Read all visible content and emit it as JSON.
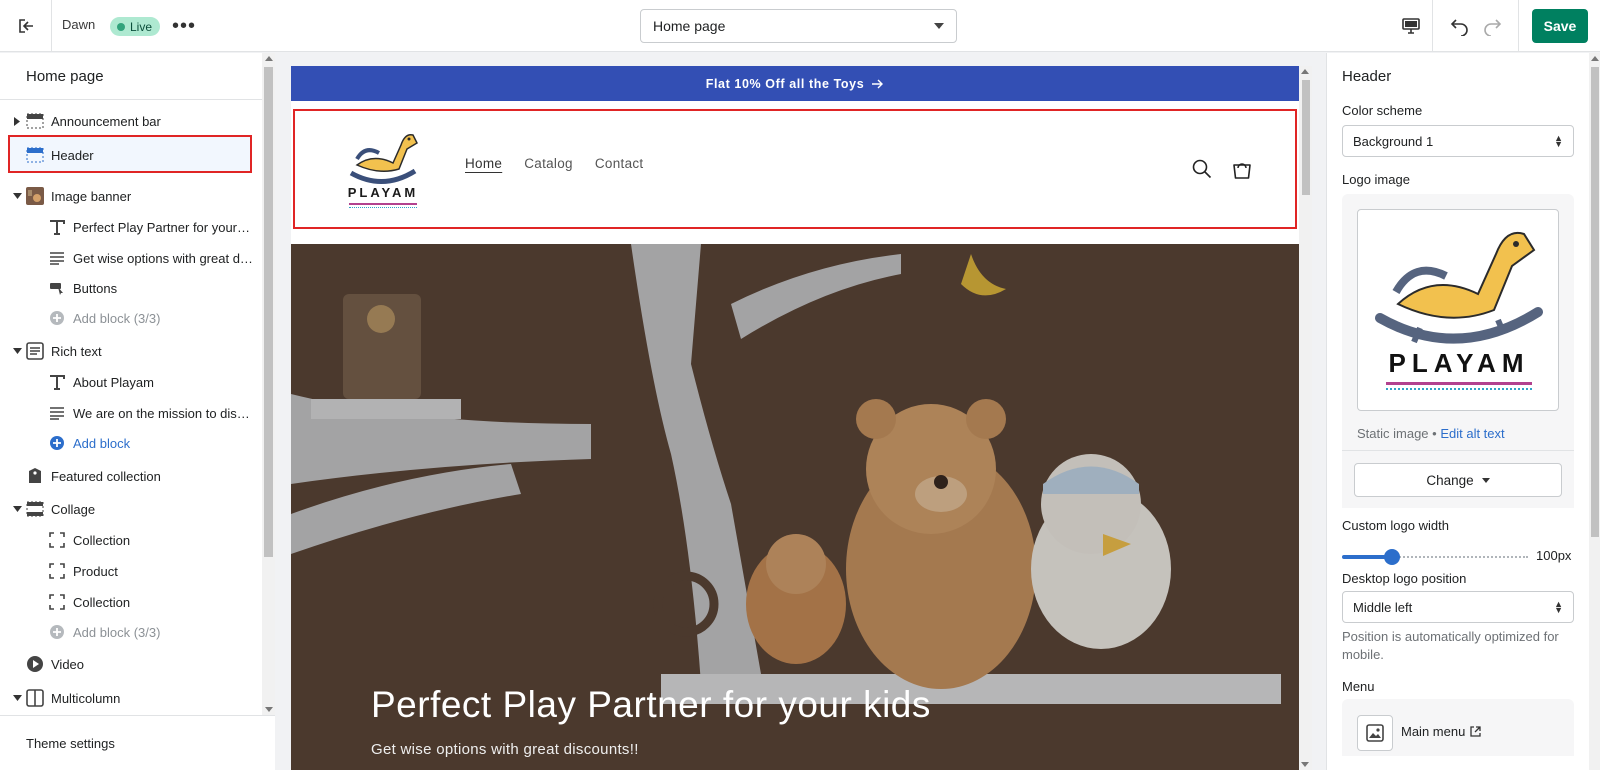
{
  "topbar": {
    "theme_name": "Dawn",
    "status_badge": "Live",
    "more_label": "•••",
    "page_selector": "Home page",
    "save_label": "Save"
  },
  "left_panel": {
    "title": "Home page",
    "items": [
      {
        "label": "Announcement bar",
        "icon": "announcement-bar-icon"
      },
      {
        "label": "Header",
        "icon": "header-section-icon"
      },
      {
        "label": "Image banner",
        "icon": "image-banner-thumbnail"
      },
      {
        "label": "Perfect Play Partner for your k...",
        "icon": "text-heading-icon"
      },
      {
        "label": "Get wise options with great di...",
        "icon": "paragraph-icon"
      },
      {
        "label": "Buttons",
        "icon": "buttons-icon"
      },
      {
        "label": "Add block (3/3)",
        "icon": "add-circle-icon"
      },
      {
        "label": "Rich text",
        "icon": "rich-text-icon"
      },
      {
        "label": "About Playam",
        "icon": "text-heading-icon"
      },
      {
        "label": "We are on the mission to disc...",
        "icon": "paragraph-icon"
      },
      {
        "label": "Add block",
        "icon": "add-circle-icon"
      },
      {
        "label": "Featured collection",
        "icon": "collection-tag-icon"
      },
      {
        "label": "Collage",
        "icon": "collage-icon"
      },
      {
        "label": "Collection",
        "icon": "dashed-box-icon"
      },
      {
        "label": "Product",
        "icon": "dashed-box-icon"
      },
      {
        "label": "Collection",
        "icon": "dashed-box-icon"
      },
      {
        "label": "Add block (3/3)",
        "icon": "add-circle-icon"
      },
      {
        "label": "Video",
        "icon": "play-circle-icon"
      },
      {
        "label": "Multicolumn",
        "icon": "columns-icon"
      }
    ],
    "footer": "Theme settings"
  },
  "preview": {
    "announcement": "Flat 10% Off all the Toys",
    "logo_text": "PLAYAM",
    "nav": [
      "Home",
      "Catalog",
      "Contact"
    ],
    "banner_title": "Perfect Play Partner for your kids",
    "banner_subtitle": "Get wise options with great discounts!!"
  },
  "right_panel": {
    "title": "Header",
    "color_scheme_label": "Color scheme",
    "color_scheme_value": "Background 1",
    "logo_image_label": "Logo image",
    "logo_text": "PLAYAM",
    "static_image": "Static image •",
    "edit_alt": "Edit alt text",
    "change_label": "Change",
    "custom_logo_width_label": "Custom logo width",
    "logo_width_value": "100px",
    "logo_width_fraction": 0.27,
    "desktop_logo_position_label": "Desktop logo position",
    "desktop_logo_position_value": "Middle left",
    "hint": "Position is automatically optimized for mobile.",
    "menu_label": "Menu",
    "menu_value": "Main menu"
  },
  "colors": {
    "accent": "#008060",
    "announcement_bg": "#334fb4",
    "selection_outline": "#e02525",
    "link_blue": "#2c6ecb"
  }
}
